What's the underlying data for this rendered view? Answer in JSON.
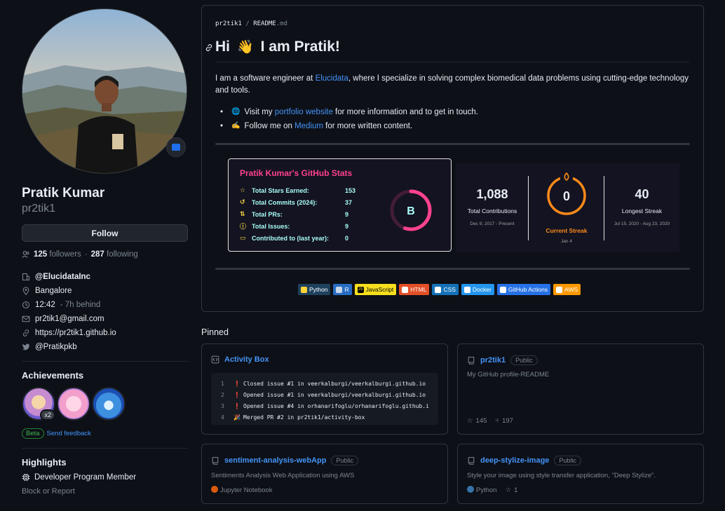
{
  "profile": {
    "fullname": "Pratik Kumar",
    "login": "pr2tik1",
    "follow_label": "Follow",
    "followers_count": "125",
    "followers_label": "followers",
    "following_count": "287",
    "following_label": "following",
    "org": "@ElucidataInc",
    "location": "Bangalore",
    "time": "12:42",
    "time_note": "- 7h behind",
    "email": "pr2tik1@gmail.com",
    "website": "https://pr2tik1.github.io",
    "twitter": "@Pratikpkb"
  },
  "achievements": {
    "title": "Achievements",
    "first_count": "x2",
    "beta_label": "Beta",
    "feedback_label": "Send feedback"
  },
  "highlights": {
    "title": "Highlights",
    "item": "Developer Program Member",
    "block_label": "Block or Report"
  },
  "readme": {
    "crumb_user": "pr2tik1",
    "crumb_sep": "/",
    "crumb_file": "README",
    "crumb_ext": ".md",
    "heading_hi": "Hi",
    "heading_wave": "👋",
    "heading_rest": "I am Pratik!",
    "intro_before": "I am a software engineer at ",
    "intro_link": "Elucidata",
    "intro_after": ", where I specialize in solving complex biomedical data problems using cutting-edge technology and tools.",
    "b1_icon": "🌐",
    "b1_before": "Visit my ",
    "b1_link": "portfolio website",
    "b1_after": " for more information and to get in touch.",
    "b2_icon": "✍️",
    "b2_before": "Follow me on ",
    "b2_link": "Medium",
    "b2_after": " for more written content."
  },
  "stats": {
    "title": "Pratik Kumar's GitHub Stats",
    "rows": [
      {
        "label": "Total Stars Earned:",
        "value": "153"
      },
      {
        "label": "Total Commits (2024):",
        "value": "37"
      },
      {
        "label": "Total PRs:",
        "value": "9"
      },
      {
        "label": "Total Issues:",
        "value": "9"
      },
      {
        "label": "Contributed to (last year):",
        "value": "0"
      }
    ],
    "rank": "B",
    "rank_progress": 0.55
  },
  "streak": {
    "total": "1,088",
    "total_label": "Total Contributions",
    "total_range": "Dec 9, 2017 - Present",
    "current": "0",
    "current_label": "Current Streak",
    "current_date": "Jan 4",
    "longest": "40",
    "longest_label": "Longest Streak",
    "longest_range": "Jul 15, 2020 - Aug 23, 2020"
  },
  "badges": [
    {
      "label": "Python",
      "bg": "#1e415e",
      "icon_bg": "#ffd43b"
    },
    {
      "label": "R",
      "bg": "#276dc3",
      "icon_bg": "#ffffff"
    },
    {
      "label": "JavaScript",
      "bg": "#f7df1e",
      "icon_bg": "#000000"
    },
    {
      "label": "HTML",
      "bg": "#e34f26",
      "icon_bg": "#ffffff"
    },
    {
      "label": "CSS",
      "bg": "#1572b6",
      "icon_bg": "#ffffff"
    },
    {
      "label": "Docker",
      "bg": "#2496ed",
      "icon_bg": "#ffffff"
    },
    {
      "label": "GitHub Actions",
      "bg": "#2671e5",
      "icon_bg": "#ffffff"
    },
    {
      "label": "AWS",
      "bg": "#ff9900",
      "icon_bg": "#ffffff"
    }
  ],
  "pinned": {
    "title": "Pinned",
    "activity": {
      "name": "Activity Box",
      "lines": [
        {
          "n": "1",
          "icon": "❗",
          "text": "Closed issue #1 in veerkalburgi/veerkalburgi.github.io"
        },
        {
          "n": "2",
          "icon": "❗",
          "text": "Opened issue #1 in veerkalburgi/veerkalburgi.github.io"
        },
        {
          "n": "3",
          "icon": "❗",
          "text": "Opened issue #4 in orhanarifoglu/orhanarifoglu.github.i"
        },
        {
          "n": "4",
          "icon": "🎉",
          "text": "Merged PR #2 in pr2tik1/activity-box"
        }
      ]
    },
    "profile_repo": {
      "name": "pr2tik1",
      "visibility": "Public",
      "description": "My GitHub profile-README",
      "stars": "145",
      "forks": "197"
    },
    "sentiment": {
      "name": "sentiment-analysis-webApp",
      "visibility": "Public",
      "description": "Sentiments Analysis Web Application using AWS",
      "language": "Jupyter Notebook",
      "language_color": "#da5b0b"
    },
    "stylize": {
      "name": "deep-stylize-image",
      "visibility": "Public",
      "description": "Style your image using style transfer application, \"Deep Stylize\".",
      "language": "Python",
      "language_color": "#3572a5",
      "stars": "1"
    }
  }
}
